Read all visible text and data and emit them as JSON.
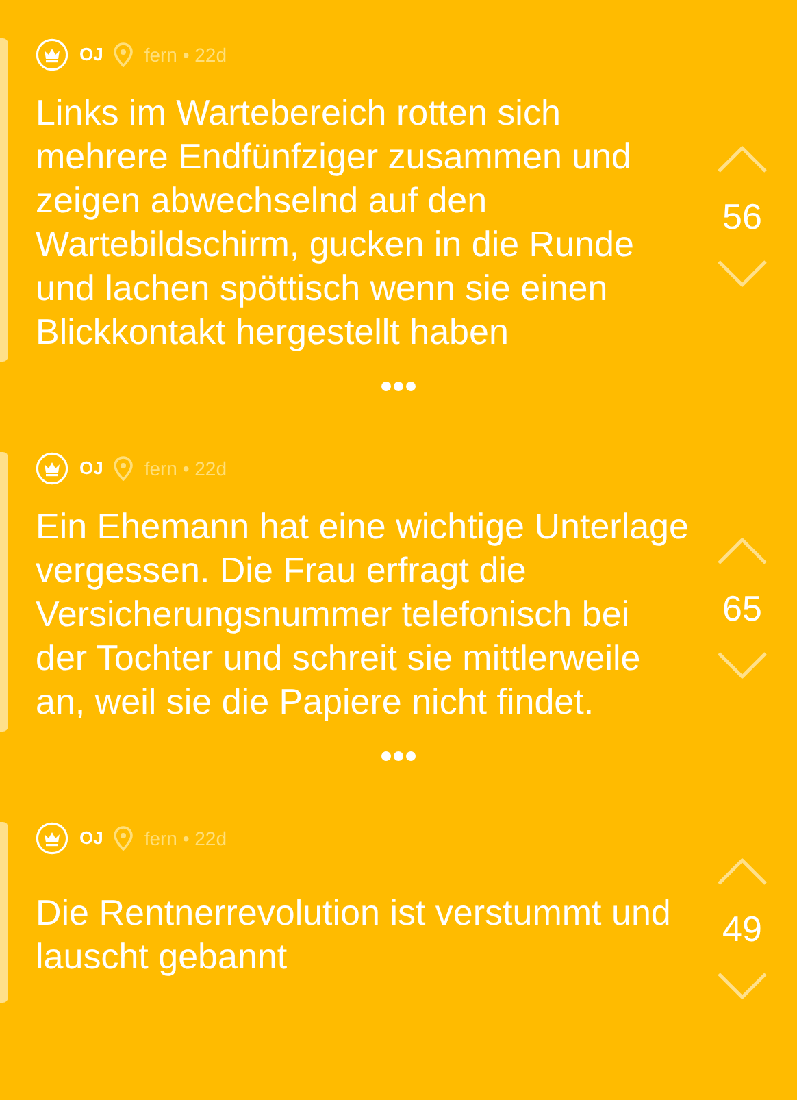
{
  "posts": [
    {
      "author": "OJ",
      "meta": "fern • 22d",
      "text": "Links im Wartebereich rotten sich mehrere Endfünfziger zusammen und zeigen abwechselnd auf den Wartebildschirm, gucken in die Runde und lachen spöttisch wenn sie einen Blickkontakt hergestellt haben",
      "votes": "56"
    },
    {
      "author": "OJ",
      "meta": "fern • 22d",
      "text": "Ein Ehemann hat eine wichtige Unterlage vergessen. Die Frau erfragt die Versicherungsnummer telefonisch bei der Tochter und schreit sie mittlerweile an, weil sie die Papiere nicht findet.",
      "votes": "65"
    },
    {
      "author": "OJ",
      "meta": "fern • 22d",
      "text": "Die Rentnerrevolution ist verstummt und lauscht gebannt",
      "votes": "49"
    }
  ]
}
